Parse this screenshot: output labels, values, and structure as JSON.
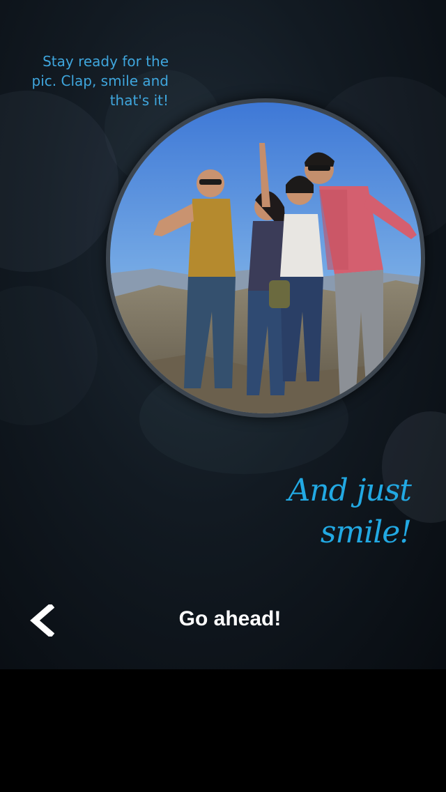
{
  "onboarding": {
    "hint": "Stay ready for the pic. Clap, smile and that's it!",
    "tagline": "And just smile!"
  },
  "nav": {
    "back_icon": "chevron-left-icon",
    "go_label": "Go ahead!"
  },
  "colors": {
    "accent": "#22a9e3",
    "hint": "#3fa6dd",
    "background": "#0c131a"
  }
}
